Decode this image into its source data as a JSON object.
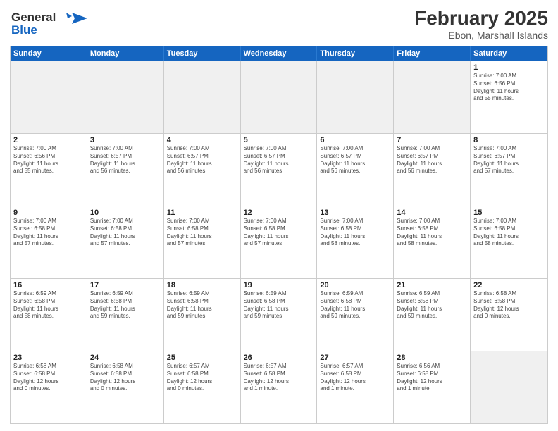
{
  "header": {
    "logo_line1": "General",
    "logo_line2": "Blue",
    "month_title": "February 2025",
    "location": "Ebon, Marshall Islands"
  },
  "weekdays": [
    "Sunday",
    "Monday",
    "Tuesday",
    "Wednesday",
    "Thursday",
    "Friday",
    "Saturday"
  ],
  "rows": [
    [
      {
        "day": "",
        "info": "",
        "shaded": true
      },
      {
        "day": "",
        "info": "",
        "shaded": true
      },
      {
        "day": "",
        "info": "",
        "shaded": true
      },
      {
        "day": "",
        "info": "",
        "shaded": true
      },
      {
        "day": "",
        "info": "",
        "shaded": true
      },
      {
        "day": "",
        "info": "",
        "shaded": true
      },
      {
        "day": "1",
        "info": "Sunrise: 7:00 AM\nSunset: 6:56 PM\nDaylight: 11 hours\nand 55 minutes."
      }
    ],
    [
      {
        "day": "2",
        "info": "Sunrise: 7:00 AM\nSunset: 6:56 PM\nDaylight: 11 hours\nand 55 minutes."
      },
      {
        "day": "3",
        "info": "Sunrise: 7:00 AM\nSunset: 6:57 PM\nDaylight: 11 hours\nand 56 minutes."
      },
      {
        "day": "4",
        "info": "Sunrise: 7:00 AM\nSunset: 6:57 PM\nDaylight: 11 hours\nand 56 minutes."
      },
      {
        "day": "5",
        "info": "Sunrise: 7:00 AM\nSunset: 6:57 PM\nDaylight: 11 hours\nand 56 minutes."
      },
      {
        "day": "6",
        "info": "Sunrise: 7:00 AM\nSunset: 6:57 PM\nDaylight: 11 hours\nand 56 minutes."
      },
      {
        "day": "7",
        "info": "Sunrise: 7:00 AM\nSunset: 6:57 PM\nDaylight: 11 hours\nand 56 minutes."
      },
      {
        "day": "8",
        "info": "Sunrise: 7:00 AM\nSunset: 6:57 PM\nDaylight: 11 hours\nand 57 minutes."
      }
    ],
    [
      {
        "day": "9",
        "info": "Sunrise: 7:00 AM\nSunset: 6:58 PM\nDaylight: 11 hours\nand 57 minutes."
      },
      {
        "day": "10",
        "info": "Sunrise: 7:00 AM\nSunset: 6:58 PM\nDaylight: 11 hours\nand 57 minutes."
      },
      {
        "day": "11",
        "info": "Sunrise: 7:00 AM\nSunset: 6:58 PM\nDaylight: 11 hours\nand 57 minutes."
      },
      {
        "day": "12",
        "info": "Sunrise: 7:00 AM\nSunset: 6:58 PM\nDaylight: 11 hours\nand 57 minutes."
      },
      {
        "day": "13",
        "info": "Sunrise: 7:00 AM\nSunset: 6:58 PM\nDaylight: 11 hours\nand 58 minutes."
      },
      {
        "day": "14",
        "info": "Sunrise: 7:00 AM\nSunset: 6:58 PM\nDaylight: 11 hours\nand 58 minutes."
      },
      {
        "day": "15",
        "info": "Sunrise: 7:00 AM\nSunset: 6:58 PM\nDaylight: 11 hours\nand 58 minutes."
      }
    ],
    [
      {
        "day": "16",
        "info": "Sunrise: 6:59 AM\nSunset: 6:58 PM\nDaylight: 11 hours\nand 58 minutes."
      },
      {
        "day": "17",
        "info": "Sunrise: 6:59 AM\nSunset: 6:58 PM\nDaylight: 11 hours\nand 59 minutes."
      },
      {
        "day": "18",
        "info": "Sunrise: 6:59 AM\nSunset: 6:58 PM\nDaylight: 11 hours\nand 59 minutes."
      },
      {
        "day": "19",
        "info": "Sunrise: 6:59 AM\nSunset: 6:58 PM\nDaylight: 11 hours\nand 59 minutes."
      },
      {
        "day": "20",
        "info": "Sunrise: 6:59 AM\nSunset: 6:58 PM\nDaylight: 11 hours\nand 59 minutes."
      },
      {
        "day": "21",
        "info": "Sunrise: 6:59 AM\nSunset: 6:58 PM\nDaylight: 11 hours\nand 59 minutes."
      },
      {
        "day": "22",
        "info": "Sunrise: 6:58 AM\nSunset: 6:58 PM\nDaylight: 12 hours\nand 0 minutes."
      }
    ],
    [
      {
        "day": "23",
        "info": "Sunrise: 6:58 AM\nSunset: 6:58 PM\nDaylight: 12 hours\nand 0 minutes."
      },
      {
        "day": "24",
        "info": "Sunrise: 6:58 AM\nSunset: 6:58 PM\nDaylight: 12 hours\nand 0 minutes."
      },
      {
        "day": "25",
        "info": "Sunrise: 6:57 AM\nSunset: 6:58 PM\nDaylight: 12 hours\nand 0 minutes."
      },
      {
        "day": "26",
        "info": "Sunrise: 6:57 AM\nSunset: 6:58 PM\nDaylight: 12 hours\nand 1 minute."
      },
      {
        "day": "27",
        "info": "Sunrise: 6:57 AM\nSunset: 6:58 PM\nDaylight: 12 hours\nand 1 minute."
      },
      {
        "day": "28",
        "info": "Sunrise: 6:56 AM\nSunset: 6:58 PM\nDaylight: 12 hours\nand 1 minute."
      },
      {
        "day": "",
        "info": "",
        "shaded": true
      }
    ]
  ]
}
